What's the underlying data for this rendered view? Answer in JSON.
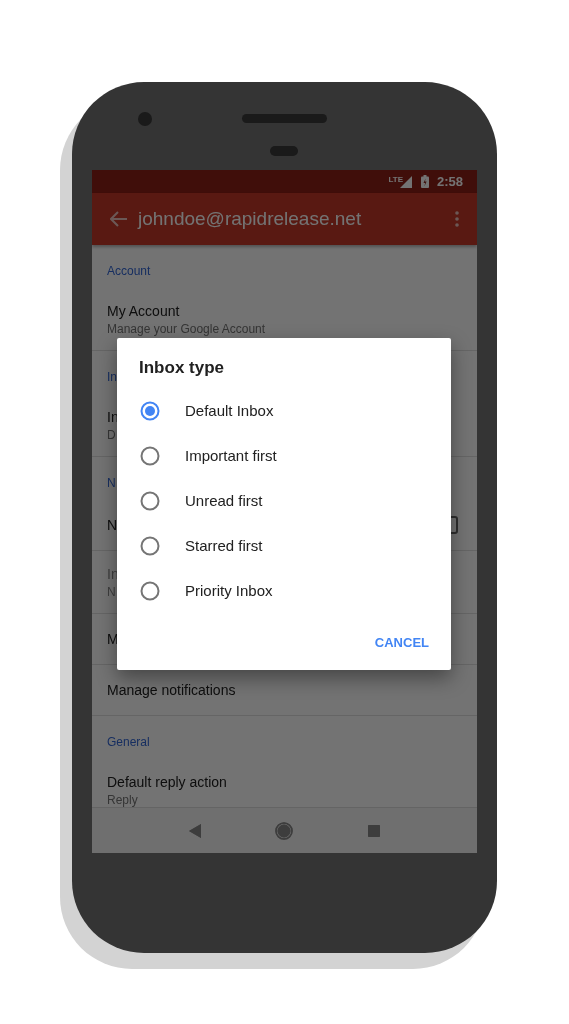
{
  "status_bar": {
    "network": "LTE",
    "time": "2:58"
  },
  "app_bar": {
    "title": "johndoe@rapidrelease.net"
  },
  "settings": [
    {
      "kind": "header",
      "title": "Account"
    },
    {
      "kind": "item",
      "title": "My Account",
      "subtitle": "Manage your Google Account",
      "disabled": false
    },
    {
      "kind": "header",
      "title": "In"
    },
    {
      "kind": "item",
      "title": "In",
      "subtitle": "D",
      "disabled": false
    },
    {
      "kind": "header",
      "title": "N"
    },
    {
      "kind": "checkbox",
      "title": "N",
      "checked": false,
      "disabled": false
    },
    {
      "kind": "item",
      "title": "In",
      "subtitle": "N",
      "disabled": true
    },
    {
      "kind": "item",
      "title": "M",
      "disabled": false
    },
    {
      "kind": "item",
      "title": "Manage notifications",
      "disabled": false
    },
    {
      "kind": "header",
      "title": "General"
    },
    {
      "kind": "item",
      "title": "Default reply action",
      "subtitle": "Reply",
      "disabled": false
    }
  ],
  "dialog": {
    "title": "Inbox type",
    "options": [
      {
        "label": "Default Inbox",
        "selected": true
      },
      {
        "label": "Important first",
        "selected": false
      },
      {
        "label": "Unread first",
        "selected": false
      },
      {
        "label": "Starred first",
        "selected": false
      },
      {
        "label": "Priority Inbox",
        "selected": false
      }
    ],
    "button": "CANCEL"
  }
}
